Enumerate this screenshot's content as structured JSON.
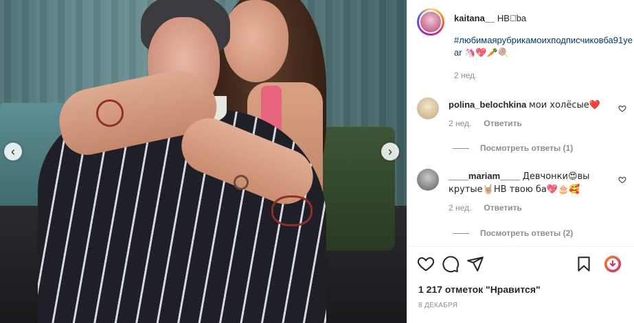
{
  "post": {
    "username": "kaitana__",
    "caption_text": "НВ\u0000ba",
    "hashtag": "#любимаярубрикамоихподписчиковба91year",
    "caption_emojis": "🦄💖🥕🍭",
    "time_ago": "2 нед."
  },
  "comments": [
    {
      "username": "polina_belochkina",
      "text": "мои холёсые❤️",
      "time_ago": "2 нед.",
      "reply_label": "Ответить",
      "view_replies": "Посмотреть ответы (1)"
    },
    {
      "username": "____mariam____",
      "text": "Девчонки😍вы крутые🤘🏼НВ твою ба💖🎂🥰",
      "time_ago": "2 нед.",
      "reply_label": "Ответить",
      "view_replies": "Посмотреть ответы (2)"
    }
  ],
  "actions": {
    "like_icon": "heart-outline-icon",
    "comment_icon": "comment-bubble-icon",
    "share_icon": "paper-plane-icon",
    "save_icon": "bookmark-icon",
    "extra_icon": "download-badge-icon"
  },
  "likes_text": "1 217 отметок \"Нравится\"",
  "date_text": "8 ДЕКАБРЯ",
  "carousel": {
    "prev_glyph": "‹",
    "next_glyph": "›"
  },
  "colors": {
    "hashtag": "#00376b",
    "meta": "#8e8e8e",
    "heart_red": "#ed4956",
    "badge_gradient_start": "#fa7e1e",
    "badge_gradient_end": "#d62976"
  }
}
